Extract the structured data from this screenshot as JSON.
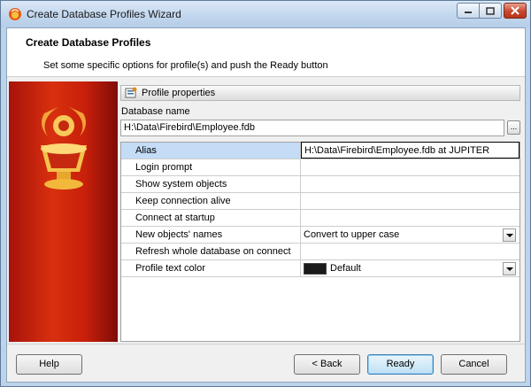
{
  "window": {
    "title": "Create Database Profiles Wizard"
  },
  "header": {
    "title": "Create Database Profiles",
    "subtitle": "Set some specific options for profile(s) and push the Ready button"
  },
  "section": {
    "label": "Profile properties"
  },
  "database": {
    "label": "Database name",
    "value": "H:\\Data\\Firebird\\Employee.fdb",
    "browse_label": "..."
  },
  "properties": [
    {
      "name": "Alias",
      "value": "H:\\Data\\Firebird\\Employee.fdb at JUPITER"
    },
    {
      "name": "Login prompt",
      "checked": false
    },
    {
      "name": "Show system objects",
      "checked": false
    },
    {
      "name": "Keep connection alive",
      "checked": false
    },
    {
      "name": "Connect at startup",
      "checked": false
    },
    {
      "name": "New objects' names",
      "value": "Convert to upper case"
    },
    {
      "name": "Refresh whole database on connect",
      "checked": true
    },
    {
      "name": "Profile text color",
      "value": "Default",
      "color": "#1a1a1a"
    }
  ],
  "buttons": {
    "help": "Help",
    "back": "< Back",
    "ready": "Ready",
    "cancel": "Cancel"
  },
  "icons": {
    "app": "firebird-icon",
    "props": "profile-properties-icon",
    "logo": "firebird-logo"
  }
}
